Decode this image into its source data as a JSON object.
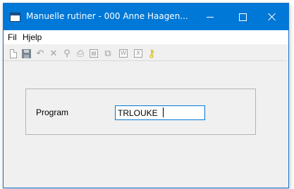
{
  "window": {
    "title": "Manuelle rutiner - 000 Anne Haagen...",
    "accent_color": "#0078d7"
  },
  "menu": {
    "items": [
      "Fil",
      "Hjelp"
    ]
  },
  "toolbar": {
    "icons": [
      "new-document-icon",
      "save-icon",
      "undo-icon",
      "delete-icon",
      "find-icon",
      "print-icon",
      "calculator-icon",
      "copy-icon",
      "word-icon",
      "excel-icon",
      "help-key-icon"
    ]
  },
  "form": {
    "program_label": "Program",
    "program_value": "TRLOUKE"
  }
}
